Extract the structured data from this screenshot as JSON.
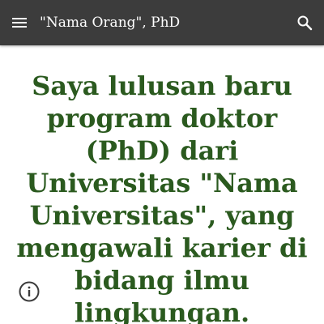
{
  "header": {
    "site_title": "\"Nama Orang\", PhD",
    "menu_icon": "hamburger-menu-icon",
    "search_icon": "search-icon"
  },
  "main": {
    "headline": "Saya lulusan baru program doktor (PhD) dari Universitas \"Nama Universitas\", yang mengawali karier di bidang ilmu lingkungan."
  },
  "footer": {
    "info_icon": "info-icon"
  },
  "colors": {
    "header_bg": "#3c3c3c",
    "headline_text": "#2b5a1f",
    "page_bg": "#ffffff"
  }
}
